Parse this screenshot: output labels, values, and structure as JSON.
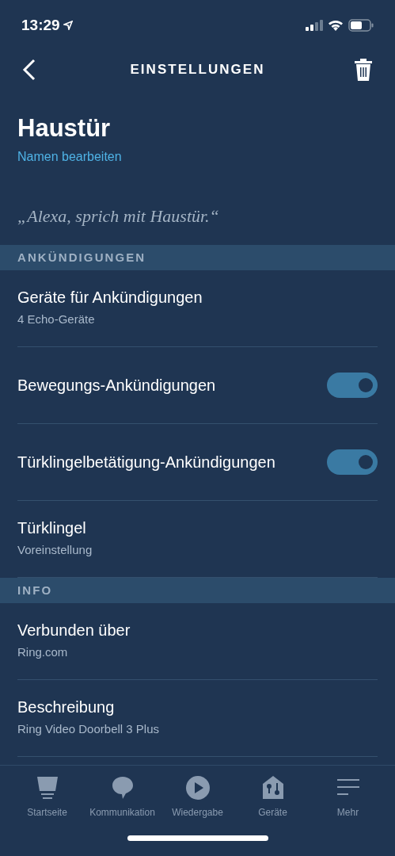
{
  "status_bar": {
    "time": "13:29"
  },
  "header": {
    "title": "EINSTELLUNGEN"
  },
  "device": {
    "name": "Haustür",
    "edit_link": "Namen bearbeiten",
    "voice_hint": "„Alexa, sprich mit Haustür.“"
  },
  "sections": [
    {
      "title": "ANKÜNDIGUNGEN",
      "rows": [
        {
          "kind": "detail",
          "label": "Geräte für Ankündigungen",
          "value": "4 Echo-Geräte"
        },
        {
          "kind": "toggle",
          "label": "Bewegungs-Ankündigungen",
          "on": true
        },
        {
          "kind": "toggle",
          "label": "Türklingelbetätigung-Ankündigungen",
          "on": true
        },
        {
          "kind": "detail",
          "label": "Türklingel",
          "value": "Voreinstellung"
        }
      ]
    },
    {
      "title": "INFO",
      "rows": [
        {
          "kind": "detail",
          "label": "Verbunden über",
          "value": "Ring.com"
        },
        {
          "kind": "detail",
          "label": "Beschreibung",
          "value": "Ring Video Doorbell 3 Plus"
        }
      ]
    }
  ],
  "tab_bar": [
    {
      "kind": "home",
      "label": "Startseite",
      "selected": false
    },
    {
      "kind": "chat",
      "label": "Kommunikation",
      "selected": false
    },
    {
      "kind": "play",
      "label": "Wiedergabe",
      "selected": false
    },
    {
      "kind": "devices",
      "label": "Geräte",
      "selected": false
    },
    {
      "kind": "more",
      "label": "Mehr",
      "selected": false
    }
  ]
}
